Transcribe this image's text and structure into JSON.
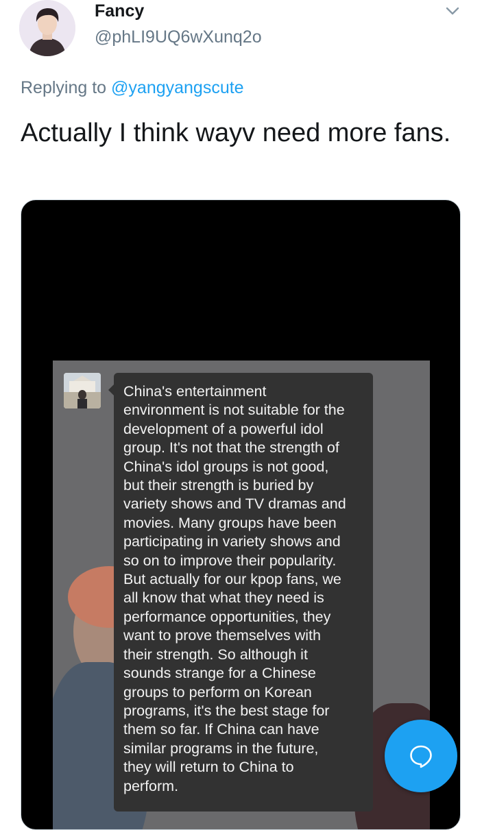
{
  "tweet": {
    "author": {
      "display_name": "Fancy",
      "handle": "@phLI9UQ6wXunq2o",
      "avatar_icon": "profile-photo"
    },
    "menu_icon": "chevron-down-icon",
    "replying_prefix": "Replying to ",
    "replying_to": "@yangyangscute",
    "text": "Actually I think wayv need more fans."
  },
  "media": {
    "message_text": "China's entertainment\nenvironment is not suitable for the\ndevelopment of a powerful idol\ngroup. It's not that the strength of\nChina's idol groups is not good,\nbut their strength is buried by\nvariety shows and TV dramas and\nmovies. Many groups have been\nparticipating in variety shows and\nso on to improve their popularity.\nBut actually for our kpop fans, we\nall know that what they need is\nperformance opportunities, they\nwant to prove themselves with\ntheir strength. So although it\nsounds strange for a Chinese\ngroups to perform on Korean\nprograms, it's the best stage for\nthem so far. If China can have\nsimilar programs in the future,\nthey will return to China to\nperform."
  },
  "fab": {
    "icon": "compose-reply-icon",
    "color": "#1da1f2"
  },
  "colors": {
    "link": "#1da1f2",
    "secondary_text": "#657786",
    "primary_text": "#14171a"
  }
}
